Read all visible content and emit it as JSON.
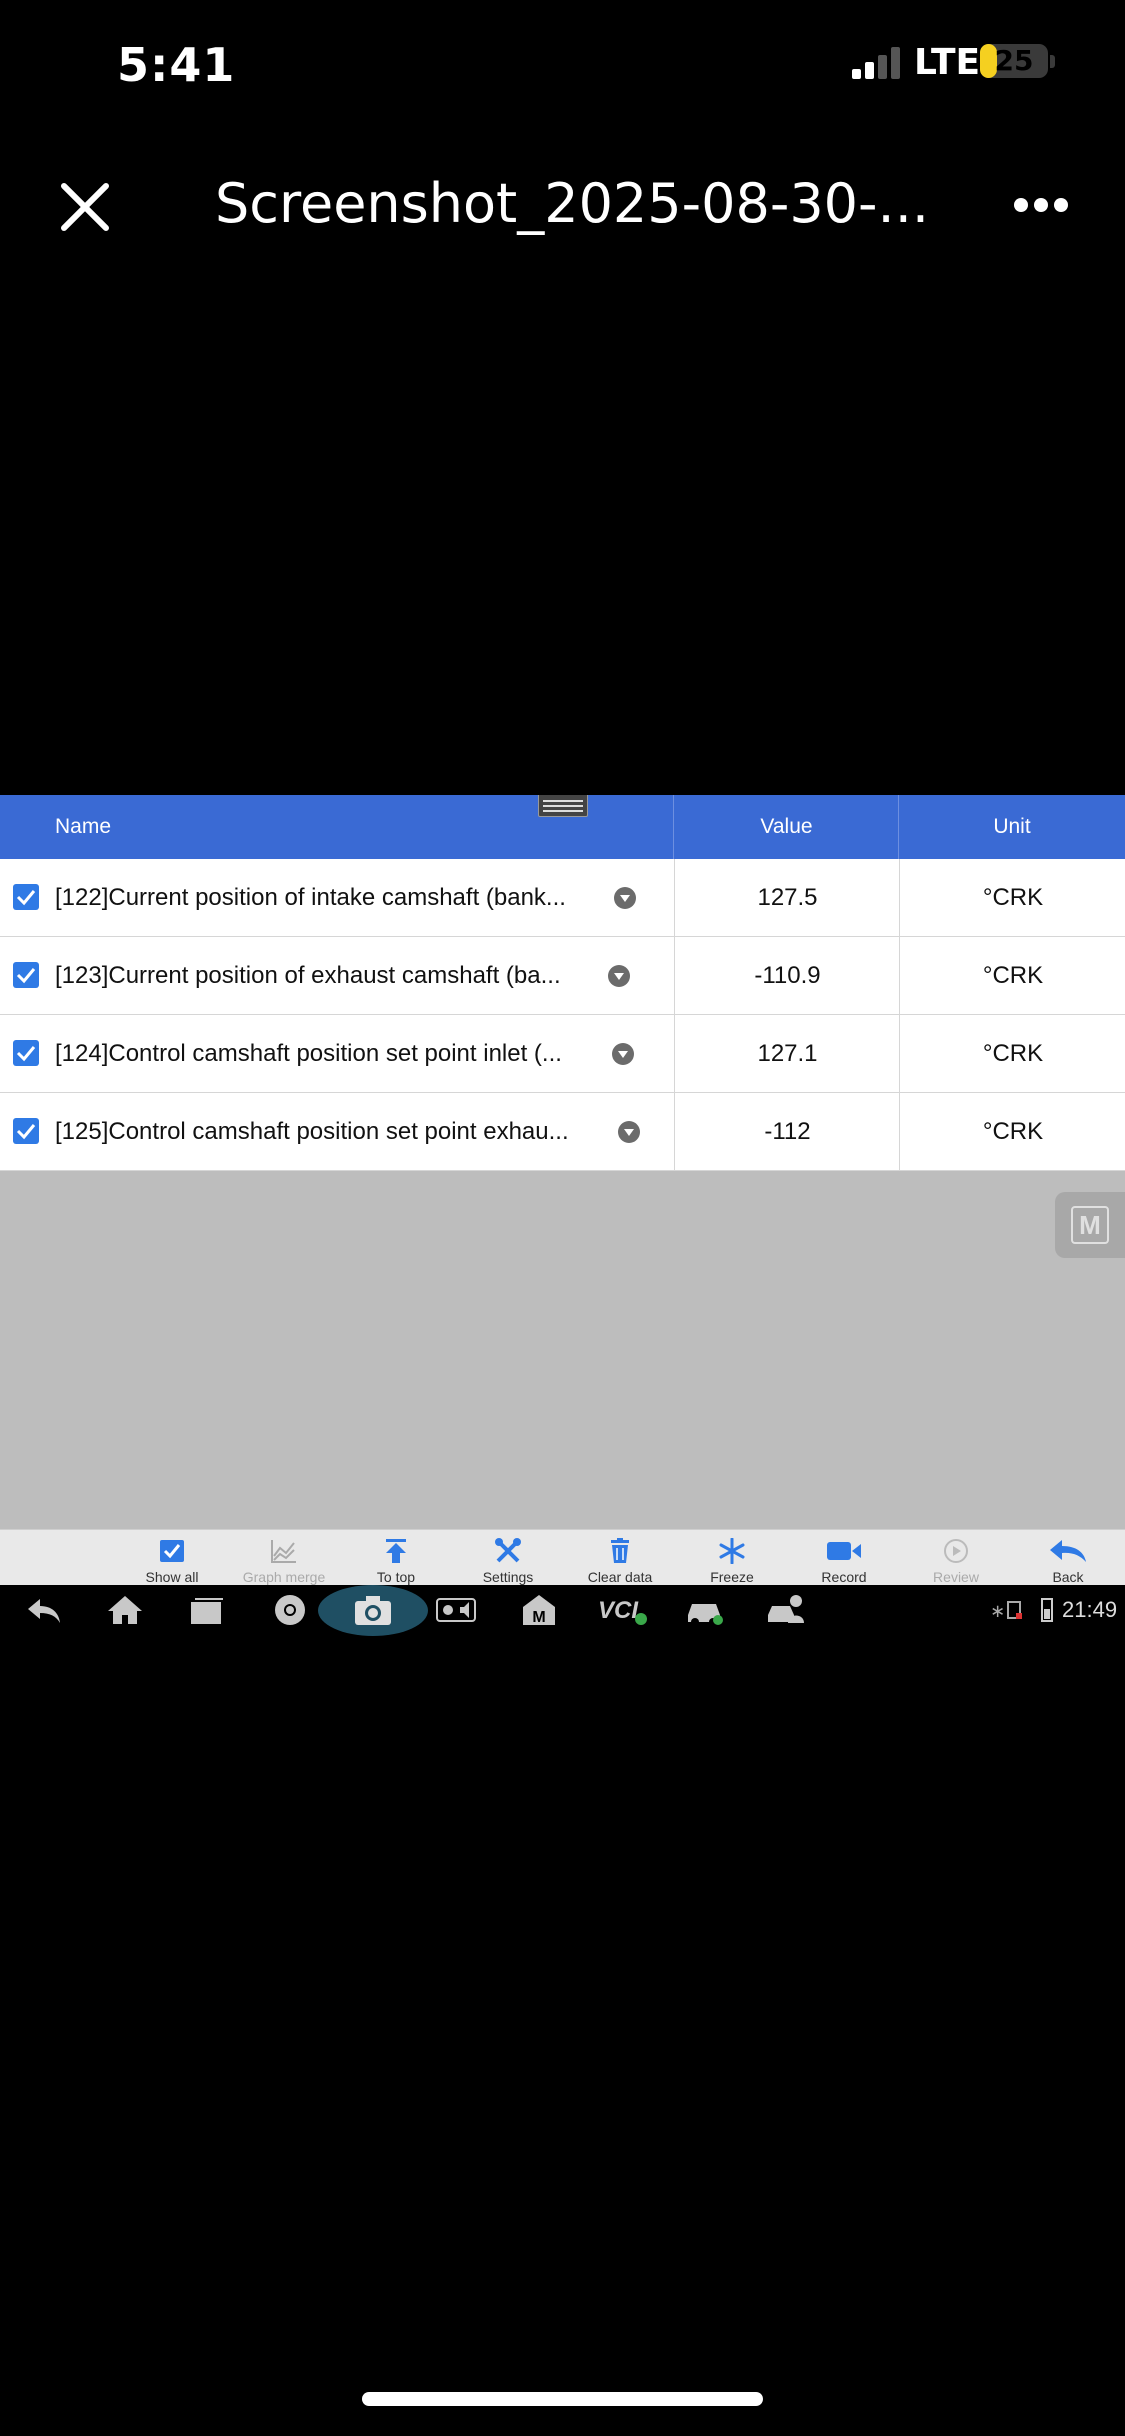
{
  "status_bar": {
    "time": "5:41",
    "network": "LTE",
    "battery": "25",
    "battery_color": "#f5d020"
  },
  "viewer": {
    "title": "Screenshot_2025-08-30-...",
    "close_icon": "close-icon",
    "more_icon": "more-icon"
  },
  "table": {
    "header": {
      "name": "Name",
      "value": "Value",
      "unit": "Unit"
    },
    "header_color": "#3a6ad4",
    "rows": [
      {
        "name": "[122]Current position of intake camshaft (bank...",
        "value": "127.5",
        "unit": "°CRK",
        "checked": true
      },
      {
        "name": "[123]Current position of exhaust camshaft (ba...",
        "value": "-110.9",
        "unit": "°CRK",
        "checked": true
      },
      {
        "name": "[124]Control camshaft position set point inlet (...",
        "value": "127.1",
        "unit": "°CRK",
        "checked": true
      },
      {
        "name": "[125]Control camshaft position set point exhau...",
        "value": "-112",
        "unit": "°CRK",
        "checked": true
      }
    ]
  },
  "toolbar": {
    "items": [
      {
        "label": "Show all",
        "icon": "checkbox-icon",
        "enabled": true
      },
      {
        "label": "Graph merge",
        "icon": "graph-icon",
        "enabled": false
      },
      {
        "label": "To top",
        "icon": "arrow-up-icon",
        "enabled": true
      },
      {
        "label": "Settings",
        "icon": "wrench-icon",
        "enabled": true
      },
      {
        "label": "Clear data",
        "icon": "trash-icon",
        "enabled": true
      },
      {
        "label": "Freeze",
        "icon": "snowflake-icon",
        "enabled": true
      },
      {
        "label": "Record",
        "icon": "video-camera-icon",
        "enabled": true
      },
      {
        "label": "Review",
        "icon": "play-icon",
        "enabled": false
      },
      {
        "label": "Back",
        "icon": "back-arrow-icon",
        "enabled": true
      }
    ]
  },
  "system_bar": {
    "time": "21:49"
  }
}
